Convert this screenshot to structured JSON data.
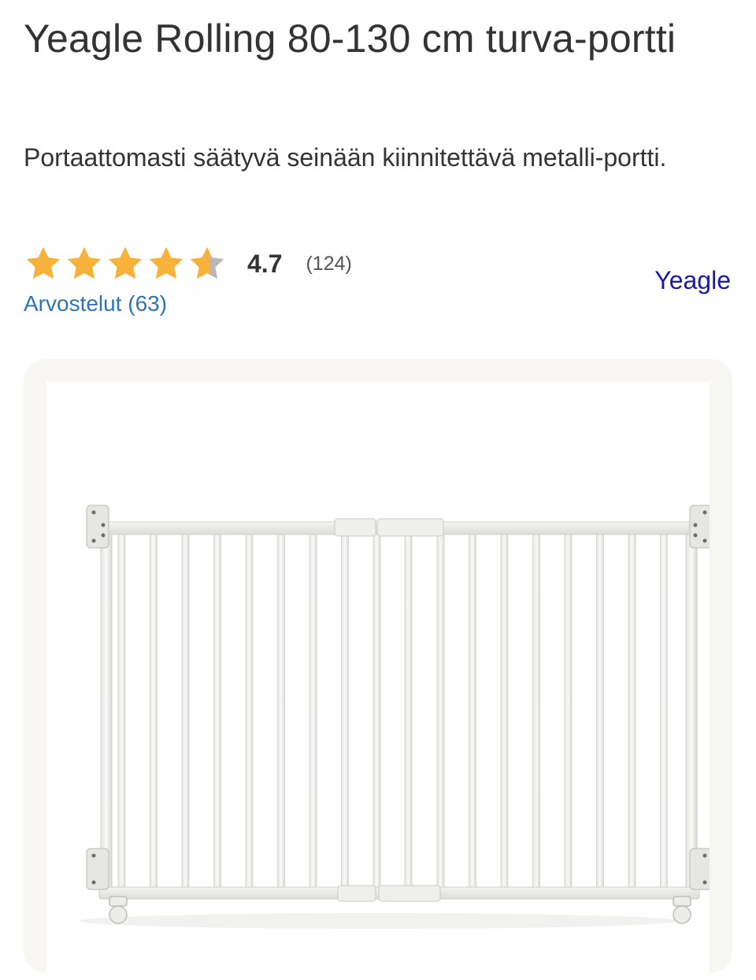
{
  "product": {
    "title": "Yeagle Rolling 80-130 cm turva-portti",
    "description": "Portaattomasti säätyvä seinään kiinnitettävä metalli-portti.",
    "rating": {
      "stars_value": 4.7,
      "stars_max": 5,
      "value_label": "4.7",
      "count_label": "(124)"
    },
    "reviews_link": "Arvostelut (63)",
    "brand_link": "Yeagle",
    "image_alt": "Yeagle Rolling turvaportti"
  },
  "colors": {
    "star_filled": "#f7b23b",
    "star_empty": "#b8b8b8",
    "link_blue": "#2a74b8",
    "brand_blue": "#1a1aa6",
    "text": "#333333",
    "card_bg": "#f7f6f3"
  }
}
